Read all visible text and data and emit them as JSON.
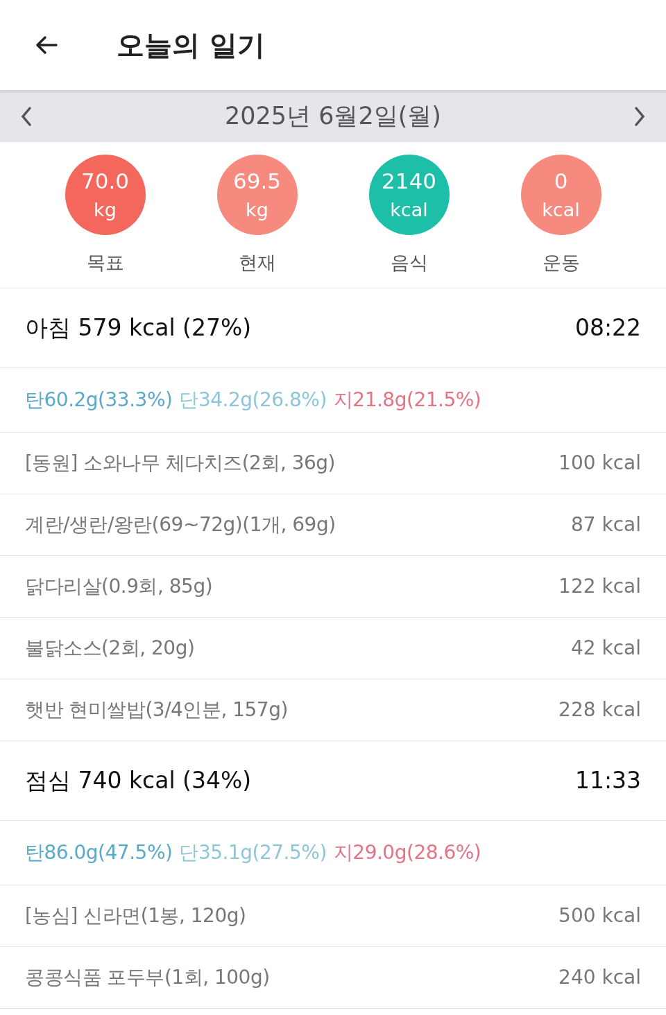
{
  "header": {
    "title": "오늘의 일기"
  },
  "date_bar": {
    "date": "2025년 6월2일(월)"
  },
  "summary": [
    {
      "value": "70.0",
      "unit": "kg",
      "label": "목표",
      "color": "#f4675c"
    },
    {
      "value": "69.5",
      "unit": "kg",
      "label": "현재",
      "color": "#f68a7f"
    },
    {
      "value": "2140",
      "unit": "kcal",
      "label": "음식",
      "color": "#1dbfa8"
    },
    {
      "value": "0",
      "unit": "kcal",
      "label": "운동",
      "color": "#f68a7f"
    }
  ],
  "meals": [
    {
      "title": "아침 579 kcal (27%)",
      "time": "08:22",
      "macros": [
        {
          "text": "탄60.2g(33.3%)",
          "color": "#5ba8c9"
        },
        {
          "text": "단34.2g(26.8%)",
          "color": "#8ec5d8"
        },
        {
          "text": "지21.8g(21.5%)",
          "color": "#e27484"
        }
      ],
      "foods": [
        {
          "name": "[동원] 소와나무 체다치즈(2회, 36g)",
          "kcal": "100 kcal"
        },
        {
          "name": "계란/생란/왕란(69~72g)(1개, 69g)",
          "kcal": "87 kcal"
        },
        {
          "name": "닭다리살(0.9회, 85g)",
          "kcal": "122 kcal"
        },
        {
          "name": "불닭소스(2회, 20g)",
          "kcal": "42 kcal"
        },
        {
          "name": "햇반 현미쌀밥(3/4인분, 157g)",
          "kcal": "228 kcal"
        }
      ]
    },
    {
      "title": "점심 740 kcal (34%)",
      "time": "11:33",
      "macros": [
        {
          "text": "탄86.0g(47.5%)",
          "color": "#5ba8c9"
        },
        {
          "text": "단35.1g(27.5%)",
          "color": "#8ec5d8"
        },
        {
          "text": "지29.0g(28.6%)",
          "color": "#e27484"
        }
      ],
      "foods": [
        {
          "name": "[농심] 신라면(1봉, 120g)",
          "kcal": "500 kcal"
        },
        {
          "name": "콩콩식품 포두부(1회, 100g)",
          "kcal": "240 kcal"
        }
      ]
    }
  ]
}
